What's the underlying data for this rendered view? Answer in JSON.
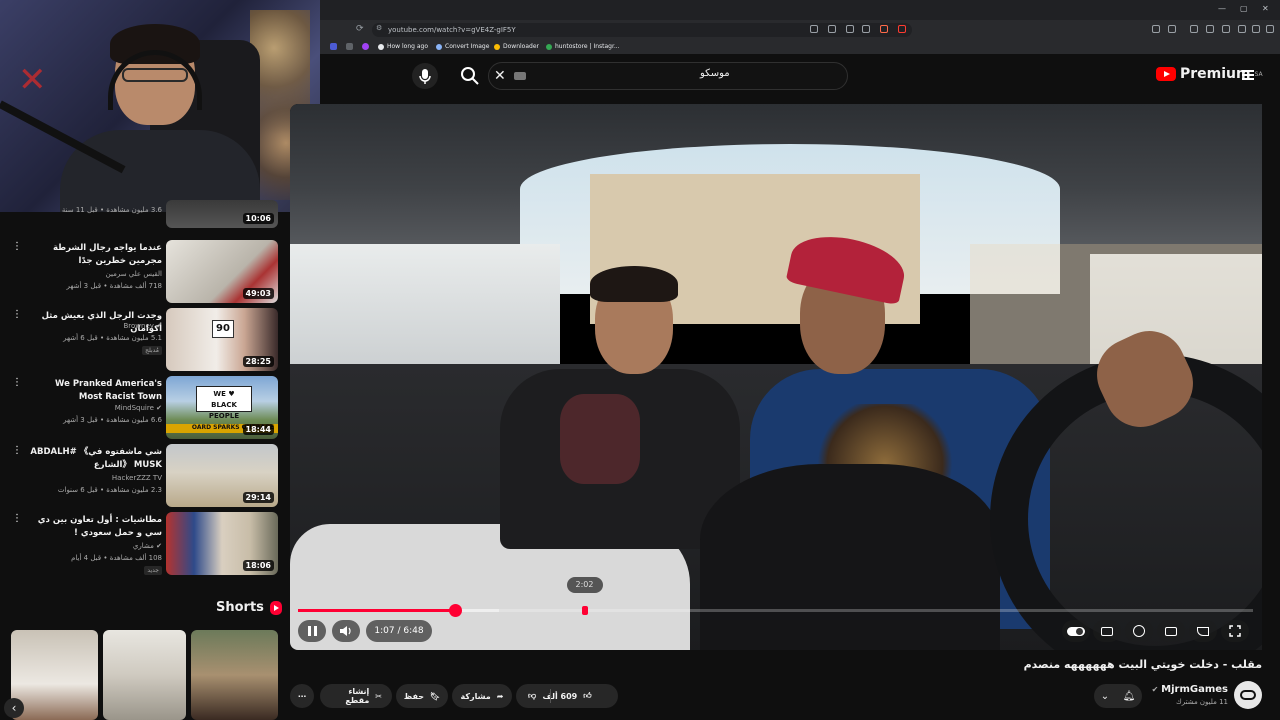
{
  "browser": {
    "url": "youtube.com/watch?v=gVE4Z-gIF5Y",
    "bookmarks": [
      "How long ago",
      "Convert Image",
      "Downloader",
      "huntostore | Instagr..."
    ],
    "bookmark_colors": [
      "#e8eaed",
      "#8ab4f8",
      "#fbbc04",
      "#34a853"
    ]
  },
  "masthead": {
    "search_value": "موسكو",
    "logo_text": "Premium",
    "logo_region": "SA"
  },
  "sidebar": {
    "top_partial": {
      "meta": "3.6 مليون مشاهدة • قبل 11 سنة",
      "duration": "10:06"
    },
    "items": [
      {
        "title": "عندما يواجه رجال الشرطة مجرمين خطرين جدًا",
        "channel": "القيس علي سرمين",
        "meta": "718 ألف مشاهدة • قبل 3 أشهر",
        "duration": "49:03",
        "verified": false,
        "badge": ""
      },
      {
        "title": "وجدت الرجل الذي يعيش مثل أكوامان",
        "channel": "Browney",
        "meta": "5.1 مليون مشاهدة • قبل 6 أشهر",
        "duration": "28:25",
        "verified": true,
        "badge": "مُدبلج"
      },
      {
        "title": "We Pranked America's Most Racist Town",
        "channel": "MindSquire",
        "meta": "6.6 مليون مشاهدة • قبل 3 أشهر",
        "duration": "18:44",
        "verified": true,
        "badge": ""
      },
      {
        "title": "ABDALH# 《شي ماشفتوه في الشارع》 MUSK",
        "channel": "HackerZZZ TV",
        "meta": "2.3 مليون مشاهدة • قبل 6 سنوات",
        "duration": "29:14",
        "verified": false,
        "badge": ""
      },
      {
        "title": "مطاشيات : أول تعاون بين دي سي و حمل سعودي !",
        "channel": "مشاري",
        "meta": "108 ألف مشاهدة • قبل 4 أيام",
        "duration": "18:06",
        "verified": true,
        "badge": "جديد"
      }
    ],
    "shorts_label": "Shorts"
  },
  "player": {
    "current_time": "1:07",
    "duration_text": "6:48",
    "time_display": "1:07 / 6:48",
    "hover_time": "2:02",
    "progress": 0.164,
    "buffered": 0.21,
    "hover_position": 0.3
  },
  "video": {
    "title": "مقلب - دخلت خويتي البيت ههههههه منصدم",
    "channel": "MjrmGames",
    "subscribers": "11 مليون مشترك",
    "likes": "609 ألف",
    "share_label": "مشاركة",
    "save_label": "حفظ",
    "clip_label": "إنشاء مقطع"
  },
  "colors": {
    "accent": "#ff0033",
    "background": "#0f0f0f",
    "pill": "#272727"
  }
}
